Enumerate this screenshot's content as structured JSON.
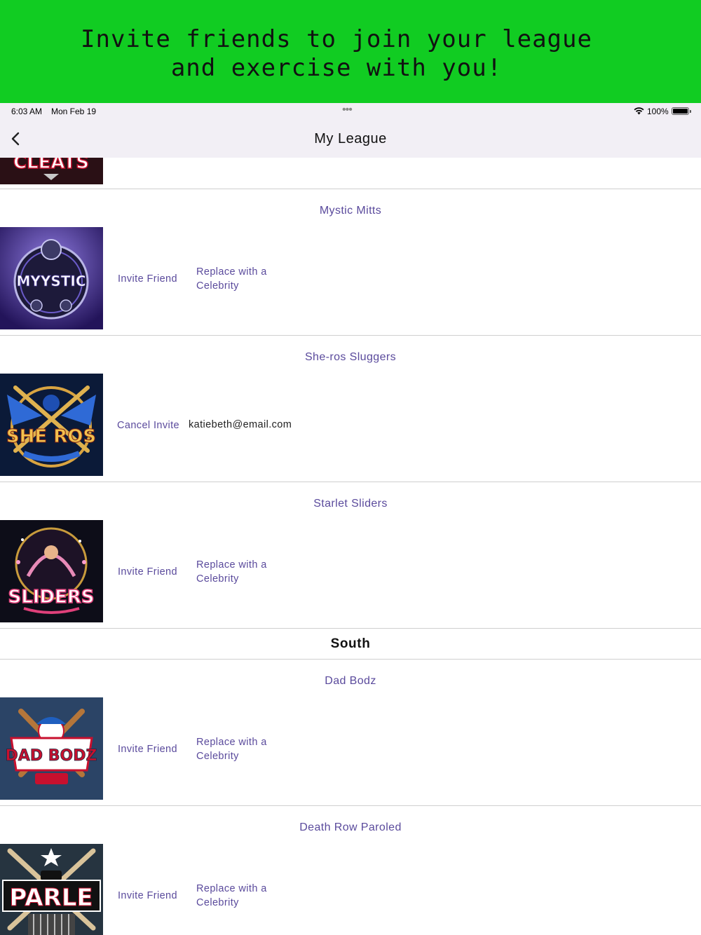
{
  "promo": {
    "line1": "Invite friends to join your league",
    "line2": "and exercise with you!"
  },
  "status_bar": {
    "time": "6:03 AM",
    "date": "Mon Feb 19",
    "battery": "100%"
  },
  "nav": {
    "title": "My League"
  },
  "partial_logo_text": "CLEATS",
  "teams": [
    {
      "name": "Mystic Mitts",
      "logo_text": "MYYSTIC",
      "action": "Invite Friend",
      "secondary": "Replace with a Celebrity"
    },
    {
      "name": "She-ros Sluggers",
      "logo_text": "SHE ROS",
      "action": "Cancel Invite",
      "email": "katiebeth@email.com"
    },
    {
      "name": "Starlet Sliders",
      "logo_text": "SLIDERS",
      "action": "Invite Friend",
      "secondary": "Replace with a Celebrity"
    }
  ],
  "division": "South",
  "south_teams": [
    {
      "name": "Dad Bodz",
      "logo_text": "DAD BODZ",
      "action": "Invite Friend",
      "secondary": "Replace with a Celebrity"
    },
    {
      "name": "Death Row Paroled",
      "logo_text": "PARLE",
      "action": "Invite Friend",
      "secondary": "Replace with a Celebrity"
    }
  ]
}
